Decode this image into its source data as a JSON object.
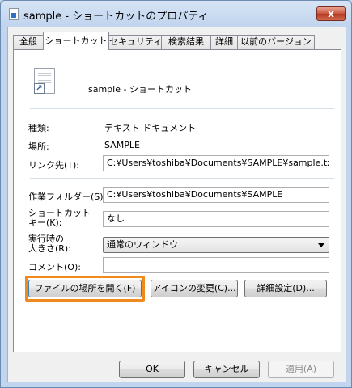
{
  "window": {
    "title": "sample - ショートカットのプロパティ",
    "close_glyph": "x"
  },
  "tabs": [
    {
      "label": "全般"
    },
    {
      "label": "ショートカット",
      "active": true
    },
    {
      "label": "セキュリティ"
    },
    {
      "label": "検索結果"
    },
    {
      "label": "詳細"
    },
    {
      "label": "以前のバージョン"
    }
  ],
  "header": {
    "name": "sample - ショートカット"
  },
  "info": {
    "type_label": "種類:",
    "type_value": "テキスト ドキュメント",
    "location_label": "場所:",
    "location_value": "SAMPLE"
  },
  "fields": {
    "target_label": "リンク先(T):",
    "target_value": "C:¥Users¥toshiba¥Documents¥SAMPLE¥sample.txt",
    "workdir_label": "作業フォルダー(S):",
    "workdir_value": "C:¥Users¥toshiba¥Documents¥SAMPLE",
    "shortcut_key_label_1": "ショートカット",
    "shortcut_key_label_2": "キー(K):",
    "shortcut_key_value": "なし",
    "run_label_1": "実行時の",
    "run_label_2": "大きさ(R):",
    "run_value": "通常のウィンドウ",
    "comment_label": "コメント(O):",
    "comment_value": ""
  },
  "actions": {
    "open_location": "ファイルの場所を開く(F)",
    "change_icon": "アイコンの変更(C)...",
    "advanced": "詳細設定(D)..."
  },
  "footer": {
    "ok": "OK",
    "cancel": "キャンセル",
    "apply": "適用(A)"
  },
  "colors": {
    "highlight": "#f08a1c"
  }
}
